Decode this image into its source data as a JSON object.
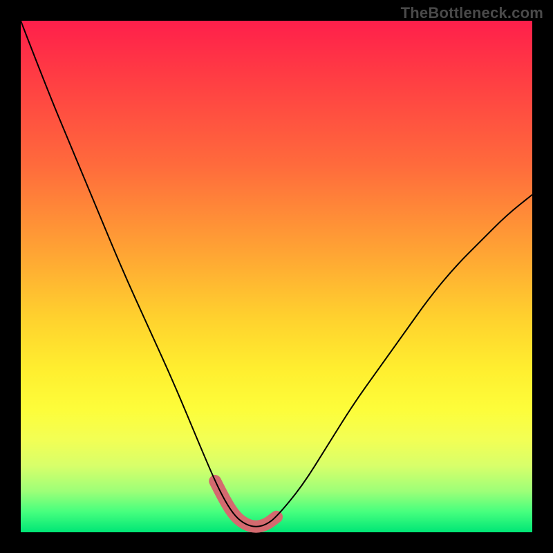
{
  "watermark": "TheBottleneck.com",
  "colors": {
    "background": "#000000",
    "curve": "#000000",
    "accent": "#d46a6f"
  },
  "chart_data": {
    "type": "line",
    "title": "",
    "xlabel": "",
    "ylabel": "",
    "xlim": [
      0,
      100
    ],
    "ylim": [
      0,
      100
    ],
    "grid": false,
    "legend": false,
    "series": [
      {
        "name": "bottleneck-curve",
        "x": [
          0,
          5,
          10,
          15,
          20,
          25,
          30,
          35,
          38,
          40,
          42,
          44,
          46,
          48,
          50,
          55,
          60,
          65,
          70,
          75,
          80,
          85,
          90,
          95,
          100
        ],
        "y": [
          100,
          87,
          75,
          63,
          51,
          40,
          29,
          17,
          10,
          6,
          3,
          1.5,
          1,
          1.5,
          3,
          9,
          17,
          25,
          32,
          39,
          46,
          52,
          57,
          62,
          66
        ]
      },
      {
        "name": "accent-region",
        "x": [
          38,
          40,
          42,
          44,
          46,
          48,
          50
        ],
        "y": [
          10,
          6,
          3,
          1.5,
          1,
          1.5,
          3
        ]
      }
    ],
    "notes": "V-shaped bottleneck curve on a red-to-green vertical gradient; thick muted-red accent marks the trough. Values estimated from pixel positions; chart has no visible axis ticks or labels."
  }
}
